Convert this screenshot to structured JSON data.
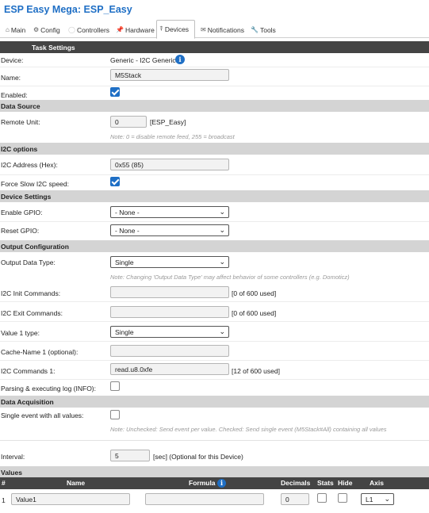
{
  "app_title": "ESP Easy Mega: ESP_Easy",
  "tabs": [
    {
      "label": "Main"
    },
    {
      "label": "Config"
    },
    {
      "label": "Controllers"
    },
    {
      "label": "Hardware"
    },
    {
      "label": "Devices"
    },
    {
      "label": "Notifications"
    },
    {
      "label": "Tools"
    }
  ],
  "task_settings": {
    "header": "Task Settings",
    "device_label": "Device:",
    "device_value": "Generic - I2C Generic",
    "name_label": "Name:",
    "name_value": "M5Stack",
    "enabled_label": "Enabled:",
    "enabled_checked": true
  },
  "data_source": {
    "header": "Data Source",
    "remote_unit_label": "Remote Unit:",
    "remote_unit_value": "0",
    "remote_unit_suffix": "[ESP_Easy]",
    "note": "Note: 0 = disable remote feed, 255 = broadcast"
  },
  "i2c_options": {
    "header": "I2C options",
    "address_label": "I2C Address (Hex):",
    "address_value": "0x55 (85)",
    "slow_label": "Force Slow I2C speed:",
    "slow_checked": true
  },
  "device_settings": {
    "header": "Device Settings",
    "enable_gpio_label": "Enable GPIO:",
    "enable_gpio_value": "- None -",
    "reset_gpio_label": "Reset GPIO:",
    "reset_gpio_value": "- None -"
  },
  "output_config": {
    "header": "Output Configuration",
    "output_type_label": "Output Data Type:",
    "output_type_value": "Single",
    "output_note": "Note: Changing 'Output Data Type' may affect behavior of some controllers (e.g. Domoticz)",
    "init_label": "I2C Init Commands:",
    "init_value": "",
    "init_used": "[0 of 600 used]",
    "exit_label": "I2C Exit Commands:",
    "exit_value": "",
    "exit_used": "[0 of 600 used]",
    "value1_type_label": "Value 1 type:",
    "value1_type_value": "Single",
    "cache_label": "Cache-Name 1 (optional):",
    "cache_value": "",
    "cmd1_label": "I2C Commands 1:",
    "cmd1_value": "read.u8.0xfe",
    "cmd1_used": "[12 of 600 used]",
    "parsing_label": "Parsing & executing log (INFO):",
    "parsing_checked": false
  },
  "data_acquisition": {
    "header": "Data Acquisition",
    "single_event_label": "Single event with all values:",
    "single_event_checked": false,
    "note": "Note: Unchecked: Send event per value. Checked: Send single event (M5Stack#All) containing all values",
    "interval_label": "Interval:",
    "interval_value": "5",
    "interval_suffix": "[sec] (Optional for this Device)"
  },
  "values": {
    "header": "Values",
    "columns": {
      "num": "#",
      "name": "Name",
      "formula": "Formula",
      "decimals": "Decimals",
      "stats": "Stats",
      "hide": "Hide",
      "axis": "Axis"
    },
    "rows": [
      {
        "num": "1",
        "name": "Value1",
        "formula": "",
        "decimals": "0",
        "stats": false,
        "hide": false,
        "axis": "L1"
      }
    ]
  },
  "colors": {
    "accent": "#1f6fc5",
    "header_dark": "#444444",
    "section_gray": "#d4d4d4"
  },
  "icons": {
    "device_info": "info-icon",
    "formula_info": "info-icon"
  }
}
